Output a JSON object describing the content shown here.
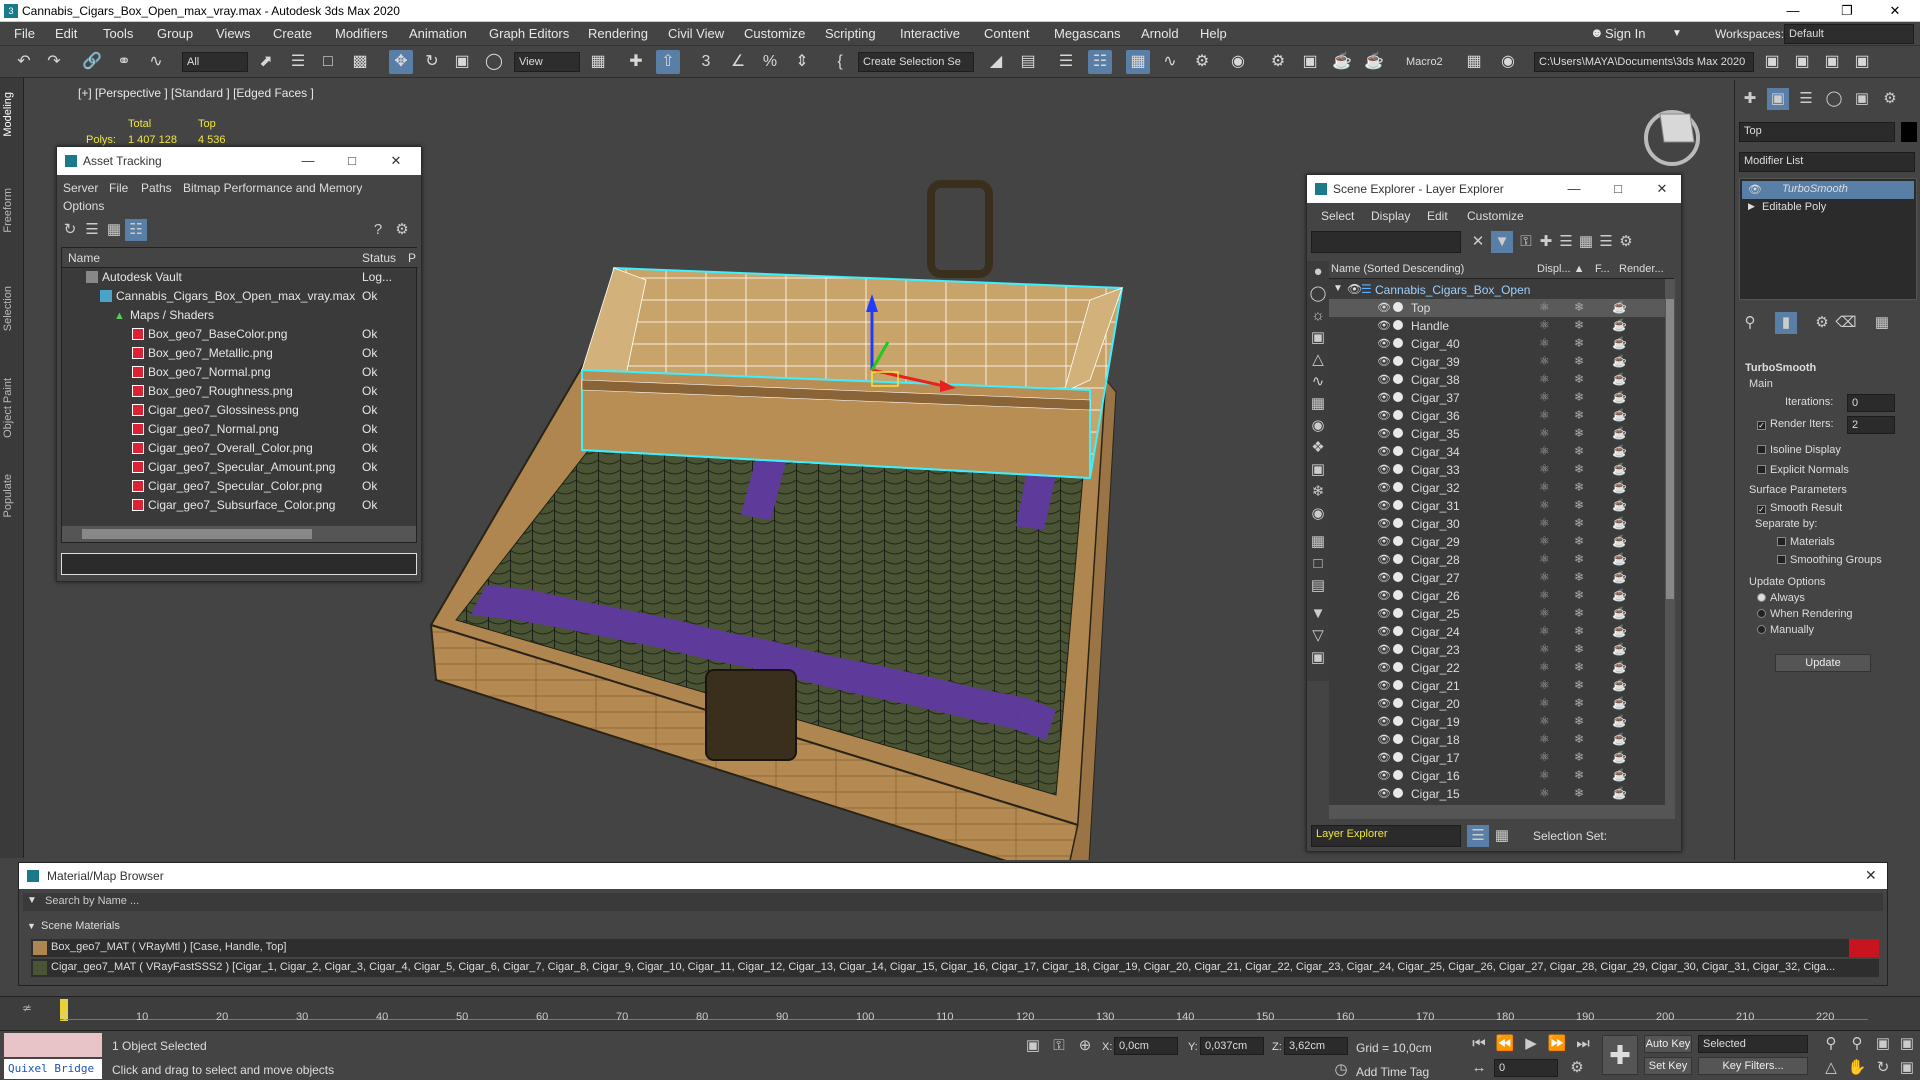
{
  "window": {
    "title": "Cannabis_Cigars_Box_Open_max_vray.max - Autodesk 3ds Max 2020"
  },
  "menu": [
    "File",
    "Edit",
    "Tools",
    "Group",
    "Views",
    "Create",
    "Modifiers",
    "Animation",
    "Graph Editors",
    "Rendering",
    "Civil View",
    "Customize",
    "Scripting",
    "Interactive",
    "Content",
    "Megascans",
    "Arnold",
    "Help"
  ],
  "signin": "Sign In",
  "workspaces_label": "Workspaces:",
  "workspaces_value": "Default",
  "toolbar": {
    "filter": "All",
    "refcoord": "View",
    "selset": "Create Selection Se",
    "macro": "Macro2",
    "path": "C:\\Users\\MAYA\\Documents\\3ds Max 2020"
  },
  "ribbon_tabs": [
    "Modeling",
    "Freeform",
    "Selection",
    "Object Paint",
    "Populate"
  ],
  "viewport": {
    "label": "[+] [Perspective ] [Standard ] [Edged Faces ]",
    "stats_total": "Total",
    "stats_top": "Top",
    "polys_label": "Polys:",
    "polys_total": "1 407 128",
    "polys_top": "4 536"
  },
  "asset": {
    "title": "Asset Tracking",
    "menu": [
      "Server",
      "File",
      "Paths",
      "Bitmap Performance and Memory",
      "Options"
    ],
    "col_name": "Name",
    "col_status": "Status",
    "col_p": "P",
    "rows": [
      {
        "name": "Autodesk Vault",
        "status": "Log..."
      },
      {
        "name": "Cannabis_Cigars_Box_Open_max_vray.max",
        "status": "Ok"
      },
      {
        "name": "Maps / Shaders",
        "status": ""
      },
      {
        "name": "Box_geo7_BaseColor.png",
        "status": "Ok"
      },
      {
        "name": "Box_geo7_Metallic.png",
        "status": "Ok"
      },
      {
        "name": "Box_geo7_Normal.png",
        "status": "Ok"
      },
      {
        "name": "Box_geo7_Roughness.png",
        "status": "Ok"
      },
      {
        "name": "Cigar_geo7_Glossiness.png",
        "status": "Ok"
      },
      {
        "name": "Cigar_geo7_Normal.png",
        "status": "Ok"
      },
      {
        "name": "Cigar_geo7_Overall_Color.png",
        "status": "Ok"
      },
      {
        "name": "Cigar_geo7_Specular_Amount.png",
        "status": "Ok"
      },
      {
        "name": "Cigar_geo7_Specular_Color.png",
        "status": "Ok"
      },
      {
        "name": "Cigar_geo7_Subsurface_Color.png",
        "status": "Ok"
      }
    ]
  },
  "scene": {
    "title": "Scene Explorer - Layer Explorer",
    "menu": [
      "Select",
      "Display",
      "Edit",
      "Customize"
    ],
    "col_name": "Name (Sorted Descending)",
    "col_disp": "Displ... ▲",
    "col_f": "F...",
    "col_render": "Render...",
    "root": "Cannabis_Cigars_Box_Open",
    "items": [
      "Top",
      "Handle",
      "Cigar_40",
      "Cigar_39",
      "Cigar_38",
      "Cigar_37",
      "Cigar_36",
      "Cigar_35",
      "Cigar_34",
      "Cigar_33",
      "Cigar_32",
      "Cigar_31",
      "Cigar_30",
      "Cigar_29",
      "Cigar_28",
      "Cigar_27",
      "Cigar_26",
      "Cigar_25",
      "Cigar_24",
      "Cigar_23",
      "Cigar_22",
      "Cigar_21",
      "Cigar_20",
      "Cigar_19",
      "Cigar_18",
      "Cigar_17",
      "Cigar_16",
      "Cigar_15"
    ],
    "footer_layer": "Layer Explorer",
    "footer_selset": "Selection Set:"
  },
  "cmd": {
    "name": "Top",
    "modlist": "Modifier List",
    "stack": [
      "TurboSmooth",
      "Editable Poly"
    ],
    "ts_title": "TurboSmooth",
    "main": "Main",
    "iterations_label": "Iterations:",
    "iterations": "0",
    "render_iters_label": "Render Iters:",
    "render_iters": "2",
    "isoline": "Isoline Display",
    "explicit": "Explicit Normals",
    "surface": "Surface Parameters",
    "smooth_result": "Smooth Result",
    "separate": "Separate by:",
    "materials": "Materials",
    "smoothing_groups": "Smoothing Groups",
    "update_opts": "Update Options",
    "always": "Always",
    "when_rendering": "When Rendering",
    "manually": "Manually",
    "update_btn": "Update"
  },
  "mat": {
    "title": "Material/Map Browser",
    "search": "Search by Name ...",
    "section": "Scene Materials",
    "row1": "Box_geo7_MAT  ( VRayMtl )  [Case, Handle, Top]",
    "row2": "Cigar_geo7_MAT  ( VRayFastSSS2 )  [Cigar_1, Cigar_2, Cigar_3, Cigar_4, Cigar_5, Cigar_6, Cigar_7, Cigar_8, Cigar_9, Cigar_10, Cigar_11, Cigar_12, Cigar_13, Cigar_14, Cigar_15, Cigar_16, Cigar_17, Cigar_18, Cigar_19, Cigar_20, Cigar_21, Cigar_22, Cigar_23, Cigar_24, Cigar_25, Cigar_26, Cigar_27, Cigar_28, Cigar_29, Cigar_30, Cigar_31, Cigar_32, Ciga..."
  },
  "timeline": {
    "ticks": [
      "0",
      "10",
      "20",
      "30",
      "40",
      "50",
      "60",
      "70",
      "80",
      "90",
      "100",
      "110",
      "120",
      "130",
      "140",
      "150",
      "160",
      "170",
      "180",
      "190",
      "200",
      "210",
      "220"
    ]
  },
  "status": {
    "quixel": "Quixel Bridge",
    "selected": "1 Object Selected",
    "prompt": "Click and drag to select and move objects",
    "x_label": "X:",
    "x": "0,0cm",
    "y_label": "Y:",
    "y": "0,037cm",
    "z_label": "Z:",
    "z": "3,62cm",
    "grid": "Grid = 10,0cm",
    "addtime": "Add Time Tag",
    "autokey": "Auto Key",
    "setkey": "Set Key",
    "selected_dd": "Selected",
    "keyfilters": "Key Filters...",
    "frame": "0"
  }
}
